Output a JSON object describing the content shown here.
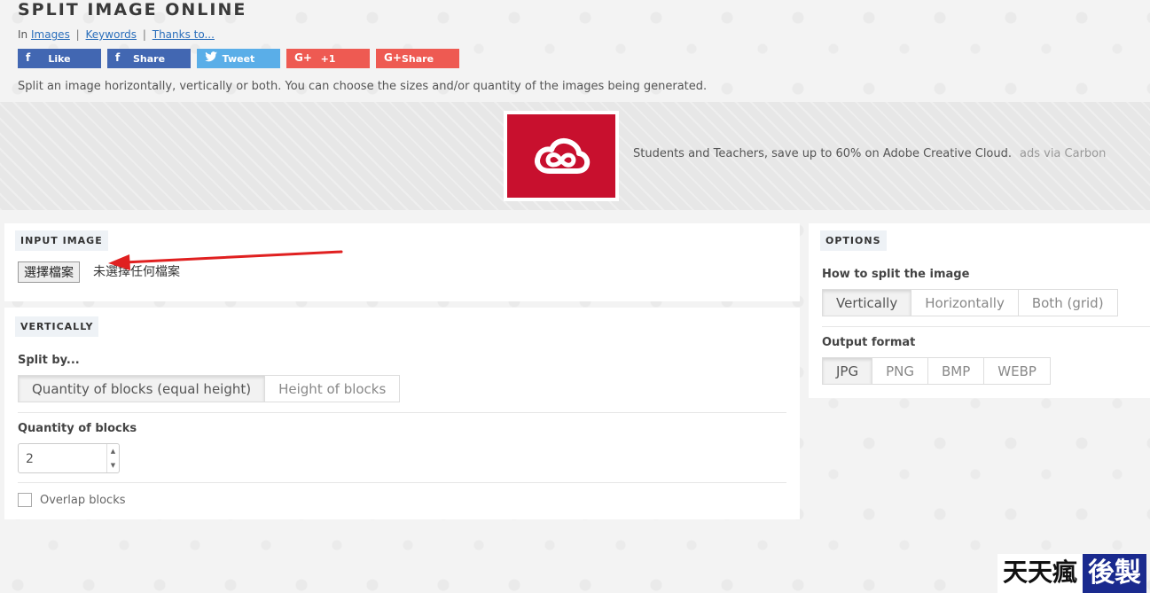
{
  "header": {
    "title": "SPLIT IMAGE ONLINE",
    "in_label": "In",
    "links": [
      "Images",
      "Keywords",
      "Thanks to..."
    ],
    "separator": "|",
    "description": "Split an image horizontally, vertically or both. You can choose the sizes and/or quantity of the images being generated."
  },
  "share": [
    {
      "icon": "f",
      "label": "Like"
    },
    {
      "icon": "f",
      "label": "Share"
    },
    {
      "icon": "t",
      "label": "Tweet"
    },
    {
      "icon": "G+",
      "label": "+1"
    },
    {
      "icon": "G+",
      "label": "Share"
    }
  ],
  "ad": {
    "text": "Students and Teachers, save up to 60% on Adobe Creative Cloud.",
    "via": "ads via Carbon",
    "brand_color": "#c8102e"
  },
  "input_image": {
    "tag": "INPUT IMAGE",
    "file_button": "選擇檔案",
    "file_status": "未選擇任何檔案"
  },
  "vertically": {
    "tag": "VERTICALLY",
    "split_by_label": "Split by...",
    "split_by_options": [
      "Quantity of blocks (equal height)",
      "Height of blocks"
    ],
    "split_by_selected": "Quantity of blocks (equal height)",
    "quantity_label": "Quantity of blocks",
    "quantity_value": "2",
    "overlap_label": "Overlap blocks"
  },
  "options": {
    "tag": "OPTIONS",
    "how_label": "How to split the image",
    "how_options": [
      "Vertically",
      "Horizontally",
      "Both (grid)"
    ],
    "how_selected": "Vertically",
    "format_label": "Output format",
    "format_options": [
      "JPG",
      "PNG",
      "BMP",
      "WEBP"
    ],
    "format_selected": "JPG"
  },
  "annotation": {
    "arrow_color": "#e02020"
  },
  "watermark": {
    "part1": "天天瘋",
    "part2": "後製"
  },
  "colors": {
    "facebook": "#4267b2",
    "twitter": "#5aaee8",
    "google": "#ee5a52",
    "link": "#2a6ebb"
  }
}
